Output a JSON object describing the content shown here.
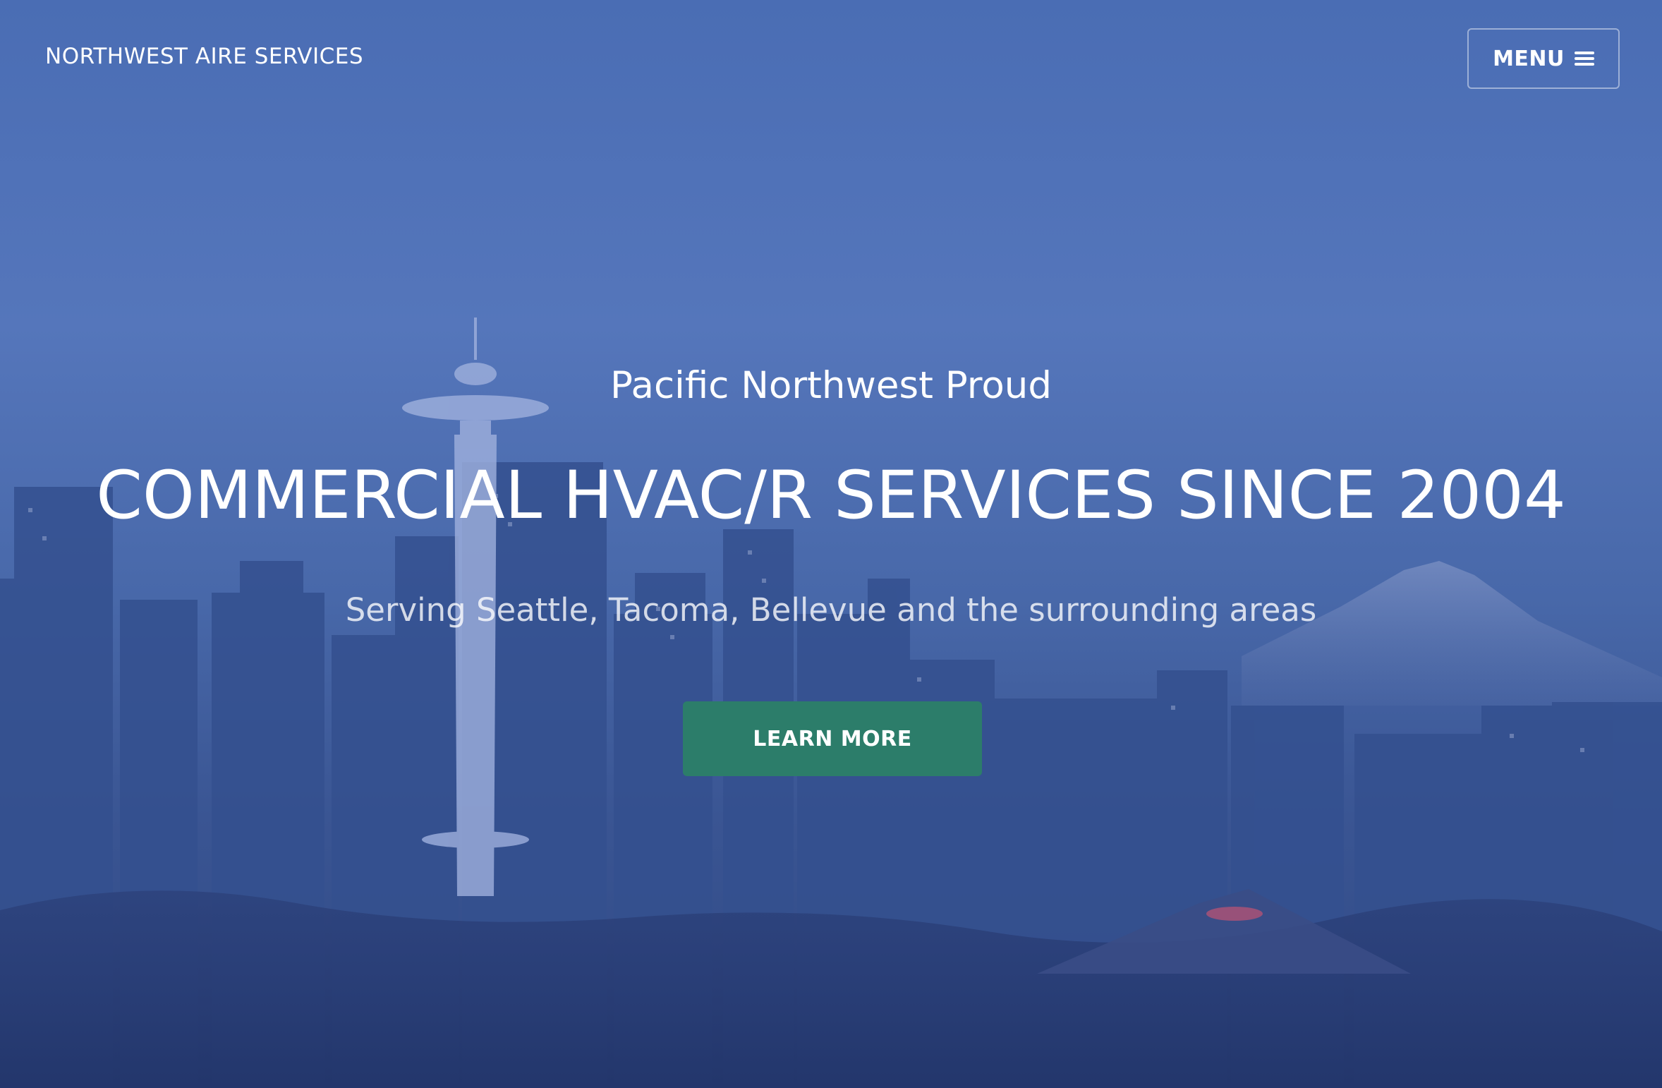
{
  "navbar": {
    "brand": "NORTHWEST AIRE SERVICES",
    "menu_label": "MENU",
    "menu_icon": "hamburger-icon"
  },
  "hero": {
    "eyebrow": "Pacific Northwest Proud",
    "headline": "COMMERCIAL HVAC/R SERVICES SINCE 2004",
    "subline": "Serving Seattle, Tacoma, Bellevue and the surrounding areas",
    "cta_label": "LEARN MORE"
  },
  "colors": {
    "overlay_blue": "#4a6db4",
    "cta_green": "#2c7d6a",
    "text": "#ffffff"
  }
}
